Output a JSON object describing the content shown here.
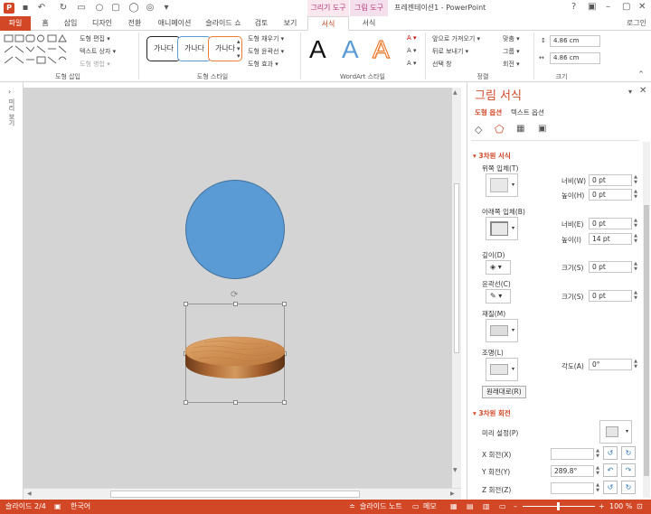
{
  "app": {
    "title": "프레젠테이션1 - PowerPoint",
    "login": "로그인",
    "context_tabs": [
      "그리기 도구",
      "그림 도구"
    ]
  },
  "tabs": [
    "파일",
    "홈",
    "삽입",
    "디자인",
    "전환",
    "애니메이션",
    "슬라이드 쇼",
    "검토",
    "보기",
    "서식",
    "서식"
  ],
  "ribbon": {
    "groups": [
      "도형 삽입",
      "도형 스타일",
      "WordArt 스타일",
      "정렬",
      "크기"
    ],
    "insert_shapes": [
      "도형 편집 ▾",
      "텍스트 상자 ▾",
      "도형 병합 ▾"
    ],
    "style_samples": [
      "가나다",
      "가나다",
      "가나다"
    ],
    "shape_fill_items": [
      "도형 채우기 ▾",
      "도형 윤곽선 ▾",
      "도형 효과 ▾"
    ],
    "wordart_letters": [
      "A",
      "A",
      "A"
    ],
    "arrange_items": [
      "앞으로 가져오기 ▾",
      "뒤로 보내기 ▾",
      "선택 창",
      "맞춤 ▾",
      "그룹 ▾",
      "회전 ▾"
    ],
    "height": "4.86 cm",
    "width": "4.86 cm",
    "colors": {
      "accent": "#d24726",
      "wordart_blue": "#5b9bd5",
      "wordart_orange": "#ed7d31"
    }
  },
  "left_strip": {
    "label": "미리 보기"
  },
  "pane": {
    "title": "그림 서식",
    "tabs": [
      "도형 옵션",
      "텍스트 옵션"
    ],
    "section_3d_format": "3차원 서식",
    "top_bevel": "위쪽 입체(T)",
    "bottom_bevel": "아래쪽 입체(B)",
    "width_label": "너비(W)",
    "height_label": "높이(H)",
    "width2_label": "너비(E)",
    "height2_label": "높이(I)",
    "top_width": "0 pt",
    "top_height": "0 pt",
    "bottom_width": "0 pt",
    "bottom_height": "14 pt",
    "depth": "깊이(D)",
    "size_label": "크기(S)",
    "depth_size": "0 pt",
    "contour": "윤곽선(C)",
    "contour_size": "0 pt",
    "material": "재질(M)",
    "lighting": "조명(L)",
    "angle_label": "각도(A)",
    "angle": "0°",
    "reset": "원래대로(R)",
    "section_3d_rotation": "3차원 회전",
    "presets": "미리 설정(P)",
    "x_rotation": "X 회전(X)",
    "x_value": "",
    "y_rotation": "Y 회전(Y)",
    "y_value": "289.8°",
    "z_rotation": "Z 회전(Z)",
    "z_value": ""
  },
  "status": {
    "slide": "슬라이드 2/4",
    "language": "한국어",
    "notes": "슬라이드 노트",
    "comments": "메모",
    "zoom": "100 %"
  }
}
